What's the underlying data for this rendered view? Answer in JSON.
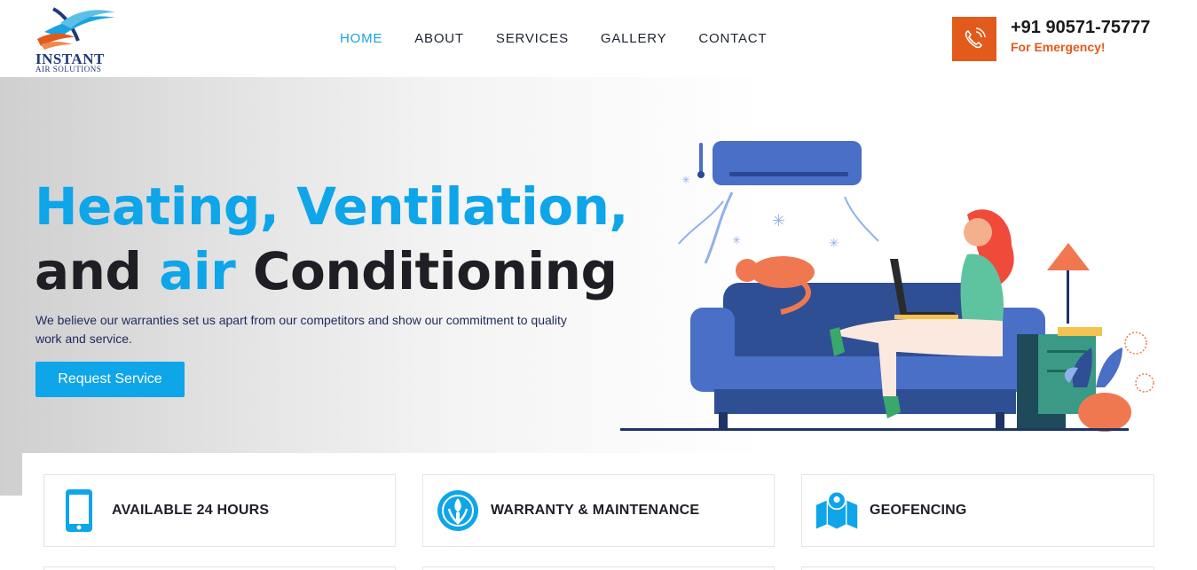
{
  "brand": {
    "name_line1": "INSTANT",
    "name_line2": "AIR SOLUTIONS"
  },
  "nav": [
    {
      "label": "HOME",
      "active": true
    },
    {
      "label": "ABOUT",
      "active": false
    },
    {
      "label": "SERVICES",
      "active": false
    },
    {
      "label": "GALLERY",
      "active": false
    },
    {
      "label": "CONTACT",
      "active": false
    }
  ],
  "contact": {
    "phone": "+91 90571-75777",
    "note": "For Emergency!"
  },
  "hero": {
    "title_line1": "Heating, Ventilation,",
    "title_line2_a": "and ",
    "title_line2_accent": "air",
    "title_line2_b": " Conditioning",
    "description": "We believe our warranties set us apart from our competitors and show our commitment to quality work and service.",
    "cta": "Request Service"
  },
  "features": [
    {
      "label": "AVAILABLE 24 HOURS",
      "icon": "mobile-phone-icon"
    },
    {
      "label": "WARRANTY & MAINTENANCE",
      "icon": "warranty-emblem-icon"
    },
    {
      "label": "GEOFENCING",
      "icon": "map-pin-icon"
    }
  ],
  "colors": {
    "accent": "#0ea5e9",
    "orange": "#e25a1c",
    "dark": "#1e1e24"
  }
}
